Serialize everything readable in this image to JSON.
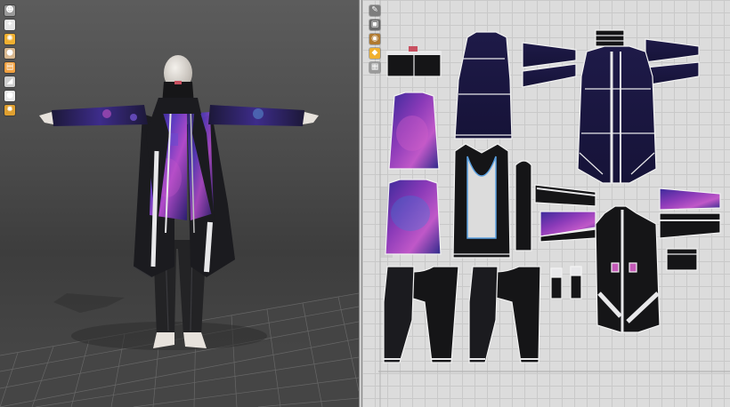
{
  "app": {
    "panels": [
      "3D Garment",
      "2D Pattern"
    ]
  },
  "toolbar_3d": [
    {
      "name": "avatar-display-icon",
      "glyph": "☻",
      "color": "#9a9a9a"
    },
    {
      "name": "garment-display-icon",
      "glyph": "✦",
      "color": "#e6e6e6"
    },
    {
      "name": "simulation-icon",
      "glyph": "✺",
      "color": "#f0b030"
    },
    {
      "name": "avatar-skin-icon",
      "glyph": "●",
      "color": "#d8b890"
    },
    {
      "name": "texture-display-icon",
      "glyph": "▤",
      "color": "#f0a040"
    },
    {
      "name": "wireframe-icon",
      "glyph": "◢",
      "color": "#cfcfcf"
    },
    {
      "name": "fabric-render-icon",
      "glyph": "●",
      "color": "#e8e8e8"
    },
    {
      "name": "render-settings-icon",
      "glyph": "✹",
      "color": "#e0a030"
    }
  ],
  "toolbar_2d": [
    {
      "name": "pattern-select-icon",
      "glyph": "✎",
      "color": "#7d7d7d"
    },
    {
      "name": "pattern-display-icon",
      "glyph": "▣",
      "color": "#6a6a6a"
    },
    {
      "name": "texture-mode-icon",
      "glyph": "◉",
      "color": "#b07a30"
    },
    {
      "name": "sewing-line-icon",
      "glyph": "◆",
      "color": "#f0b030"
    },
    {
      "name": "grid-settings-icon",
      "glyph": "▦",
      "color": "#9a9a9a"
    }
  ],
  "colors": {
    "fabric_dark": "#1b1b1f",
    "fabric_navy": "#1c1838",
    "print_purple": "#4a3aa6",
    "print_pink": "#c455c8",
    "trim_white": "#e8e8ea",
    "skin": "#e7e2dc",
    "floor_grid": "#6b6b6b",
    "pattern_outline": "#f2f2f2",
    "bg_3d": "#4e4e4e",
    "bg_2d": "#dcdcdc"
  }
}
